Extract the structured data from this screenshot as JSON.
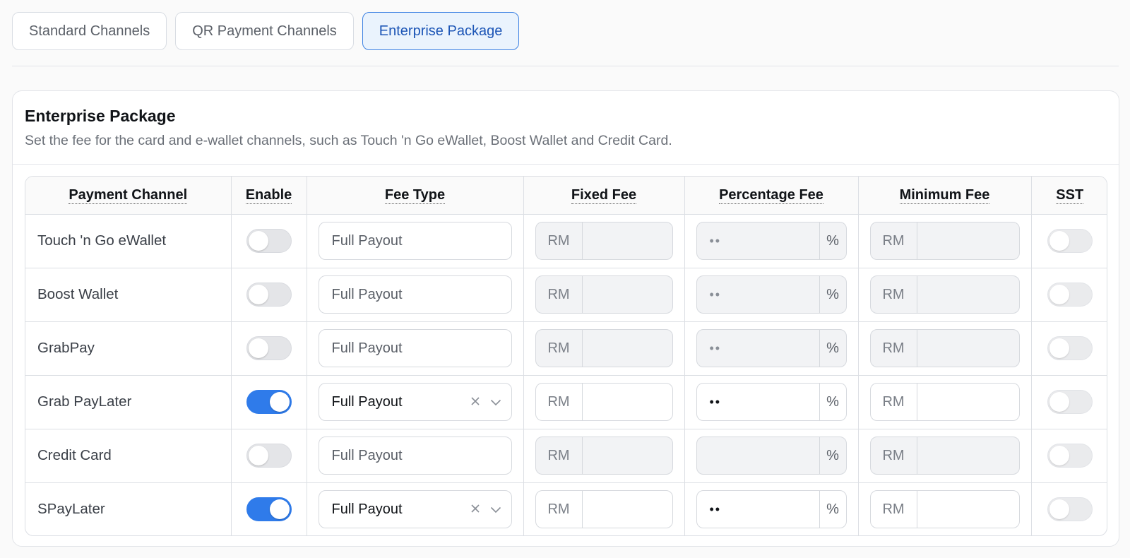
{
  "tabs": [
    {
      "label": "Standard Channels",
      "active": false
    },
    {
      "label": "QR Payment Channels",
      "active": false
    },
    {
      "label": "Enterprise Package",
      "active": true
    }
  ],
  "card": {
    "title": "Enterprise Package",
    "description": "Set the fee for the card and e-wallet channels, such as Touch 'n Go eWallet, Boost Wallet and Credit Card."
  },
  "table": {
    "headers": {
      "channel": "Payment Channel",
      "enable": "Enable",
      "fee_type": "Fee Type",
      "fixed_fee": "Fixed Fee",
      "percentage_fee": "Percentage Fee",
      "minimum_fee": "Minimum Fee",
      "sst": "SST"
    },
    "currency_prefix": "RM",
    "percent_suffix": "%",
    "rows": [
      {
        "name": "Touch 'n Go eWallet",
        "enabled": false,
        "fee_type": "Full Payout",
        "fixed_fee": "",
        "percentage_fee": "••",
        "minimum_fee": "",
        "sst": false
      },
      {
        "name": "Boost Wallet",
        "enabled": false,
        "fee_type": "Full Payout",
        "fixed_fee": "",
        "percentage_fee": "••",
        "minimum_fee": "",
        "sst": false
      },
      {
        "name": "GrabPay",
        "enabled": false,
        "fee_type": "Full Payout",
        "fixed_fee": "",
        "percentage_fee": "••",
        "minimum_fee": "",
        "sst": false
      },
      {
        "name": "Grab PayLater",
        "enabled": true,
        "fee_type": "Full Payout",
        "fixed_fee": "",
        "percentage_fee": "••",
        "minimum_fee": "",
        "sst": false
      },
      {
        "name": "Credit Card",
        "enabled": false,
        "fee_type": "Full Payout",
        "fixed_fee": "",
        "percentage_fee": "",
        "minimum_fee": "",
        "sst": false
      },
      {
        "name": "SPayLater",
        "enabled": true,
        "fee_type": "Full Payout",
        "fixed_fee": "",
        "percentage_fee": "••",
        "minimum_fee": "",
        "sst": false
      }
    ]
  },
  "icons": {
    "clear": "close-icon",
    "dropdown": "chevron-down-icon"
  },
  "colors": {
    "accent": "#2f7bea",
    "active_tab_bg": "#eaf3fd",
    "active_tab_text": "#1c55b6",
    "disabled_field_bg": "#f2f3f5"
  }
}
